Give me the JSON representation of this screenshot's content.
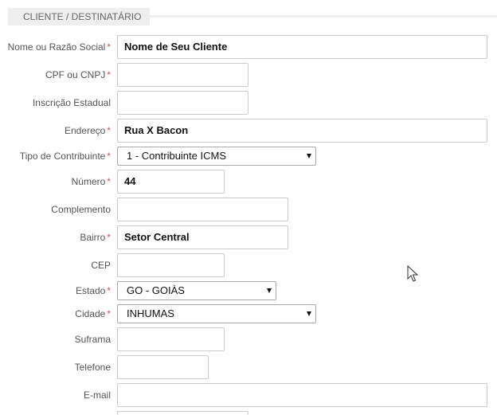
{
  "section": {
    "title": "CLIENTE / DESTINATÁRIO"
  },
  "fields": {
    "nome": {
      "label": "Nome ou Razão Social",
      "value": "Nome de Seu Cliente",
      "required": "*"
    },
    "cpf": {
      "label": "CPF ou CNPJ",
      "value": "",
      "required": "*"
    },
    "ie": {
      "label": "Inscrição Estadual",
      "value": ""
    },
    "endereco": {
      "label": "Endereço",
      "value": "Rua X Bacon",
      "required": "*"
    },
    "tipo": {
      "label": "Tipo de Contribuinte",
      "value": "1 - Contribuinte ICMS",
      "required": "*"
    },
    "numero": {
      "label": "Número",
      "value": "44",
      "required": "*"
    },
    "complemento": {
      "label": "Complemento",
      "value": ""
    },
    "bairro": {
      "label": "Bairro",
      "value": "Setor Central",
      "required": "*"
    },
    "cep": {
      "label": "CEP",
      "value": ""
    },
    "estado": {
      "label": "Estado",
      "value": "GO - GOIÀS",
      "required": "*"
    },
    "cidade": {
      "label": "Cidade",
      "value": "INHUMAS",
      "required": "*"
    },
    "suframa": {
      "label": "Suframa",
      "value": ""
    },
    "telefone": {
      "label": "Telefone",
      "value": ""
    },
    "email": {
      "label": "E-mail",
      "value": ""
    }
  }
}
